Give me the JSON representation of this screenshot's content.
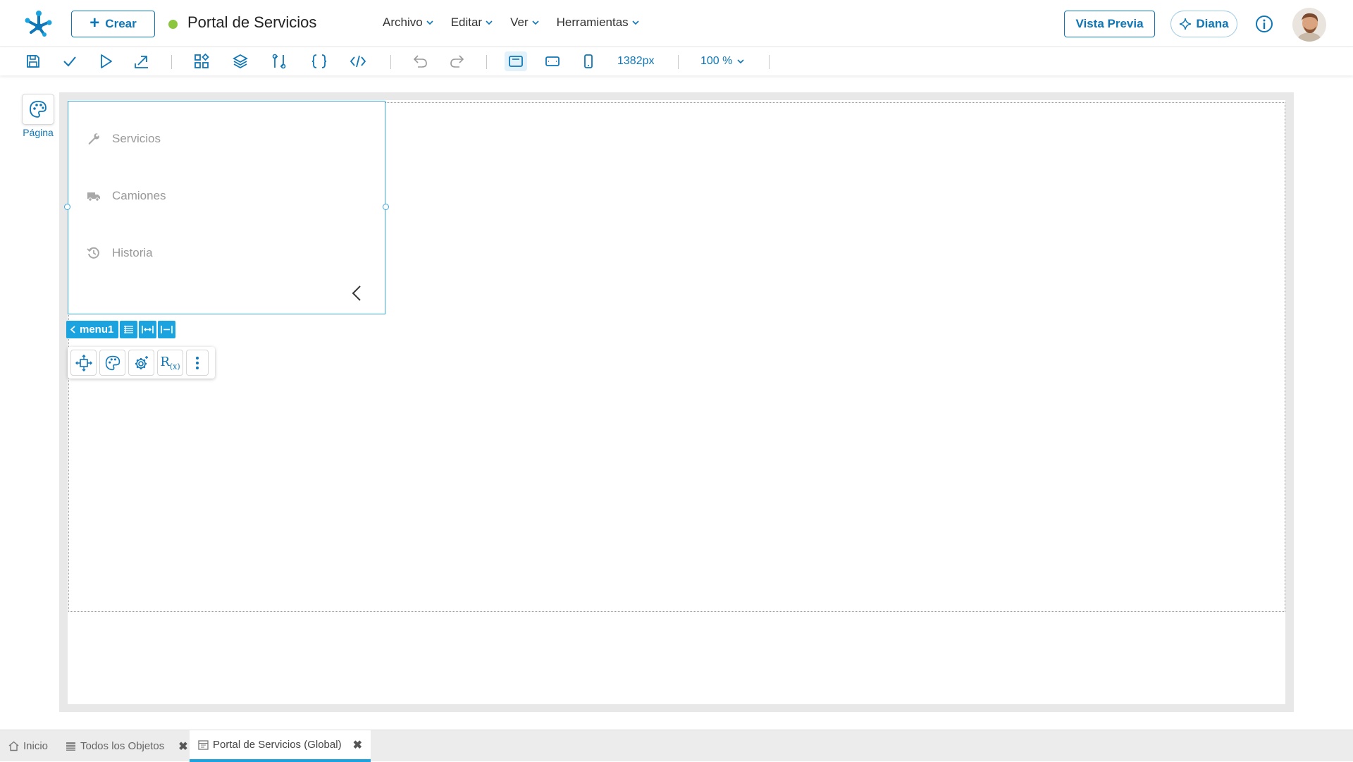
{
  "header": {
    "create_label": "Crear",
    "app_title": "Portal de Servicios",
    "status_color": "#8cc63f",
    "menus": [
      "Archivo",
      "Editar",
      "Ver",
      "Herramientas"
    ],
    "preview_label": "Vista Previa",
    "assistant_label": "Diana"
  },
  "toolbar": {
    "width_value": "1382px",
    "zoom_value": "100 %"
  },
  "side_panel": {
    "page_label": "Página"
  },
  "menu_component": {
    "items": [
      {
        "label": "Servicios",
        "icon": "wrench-icon"
      },
      {
        "label": "Camiones",
        "icon": "truck-icon"
      },
      {
        "label": "Historia",
        "icon": "history-icon"
      }
    ],
    "tag_name": "menu1"
  },
  "bottom_tabs": [
    {
      "label": "Inicio",
      "icon": "home-icon",
      "closable": false
    },
    {
      "label": "Todos los Objetos",
      "icon": "list-icon",
      "closable": true
    },
    {
      "label": "Portal de Servicios (Global)",
      "icon": "page-icon",
      "closable": true,
      "active": true
    }
  ],
  "colors": {
    "accent": "#0f77b7",
    "selection": "#1aa3df",
    "status_green": "#8cc63f"
  }
}
